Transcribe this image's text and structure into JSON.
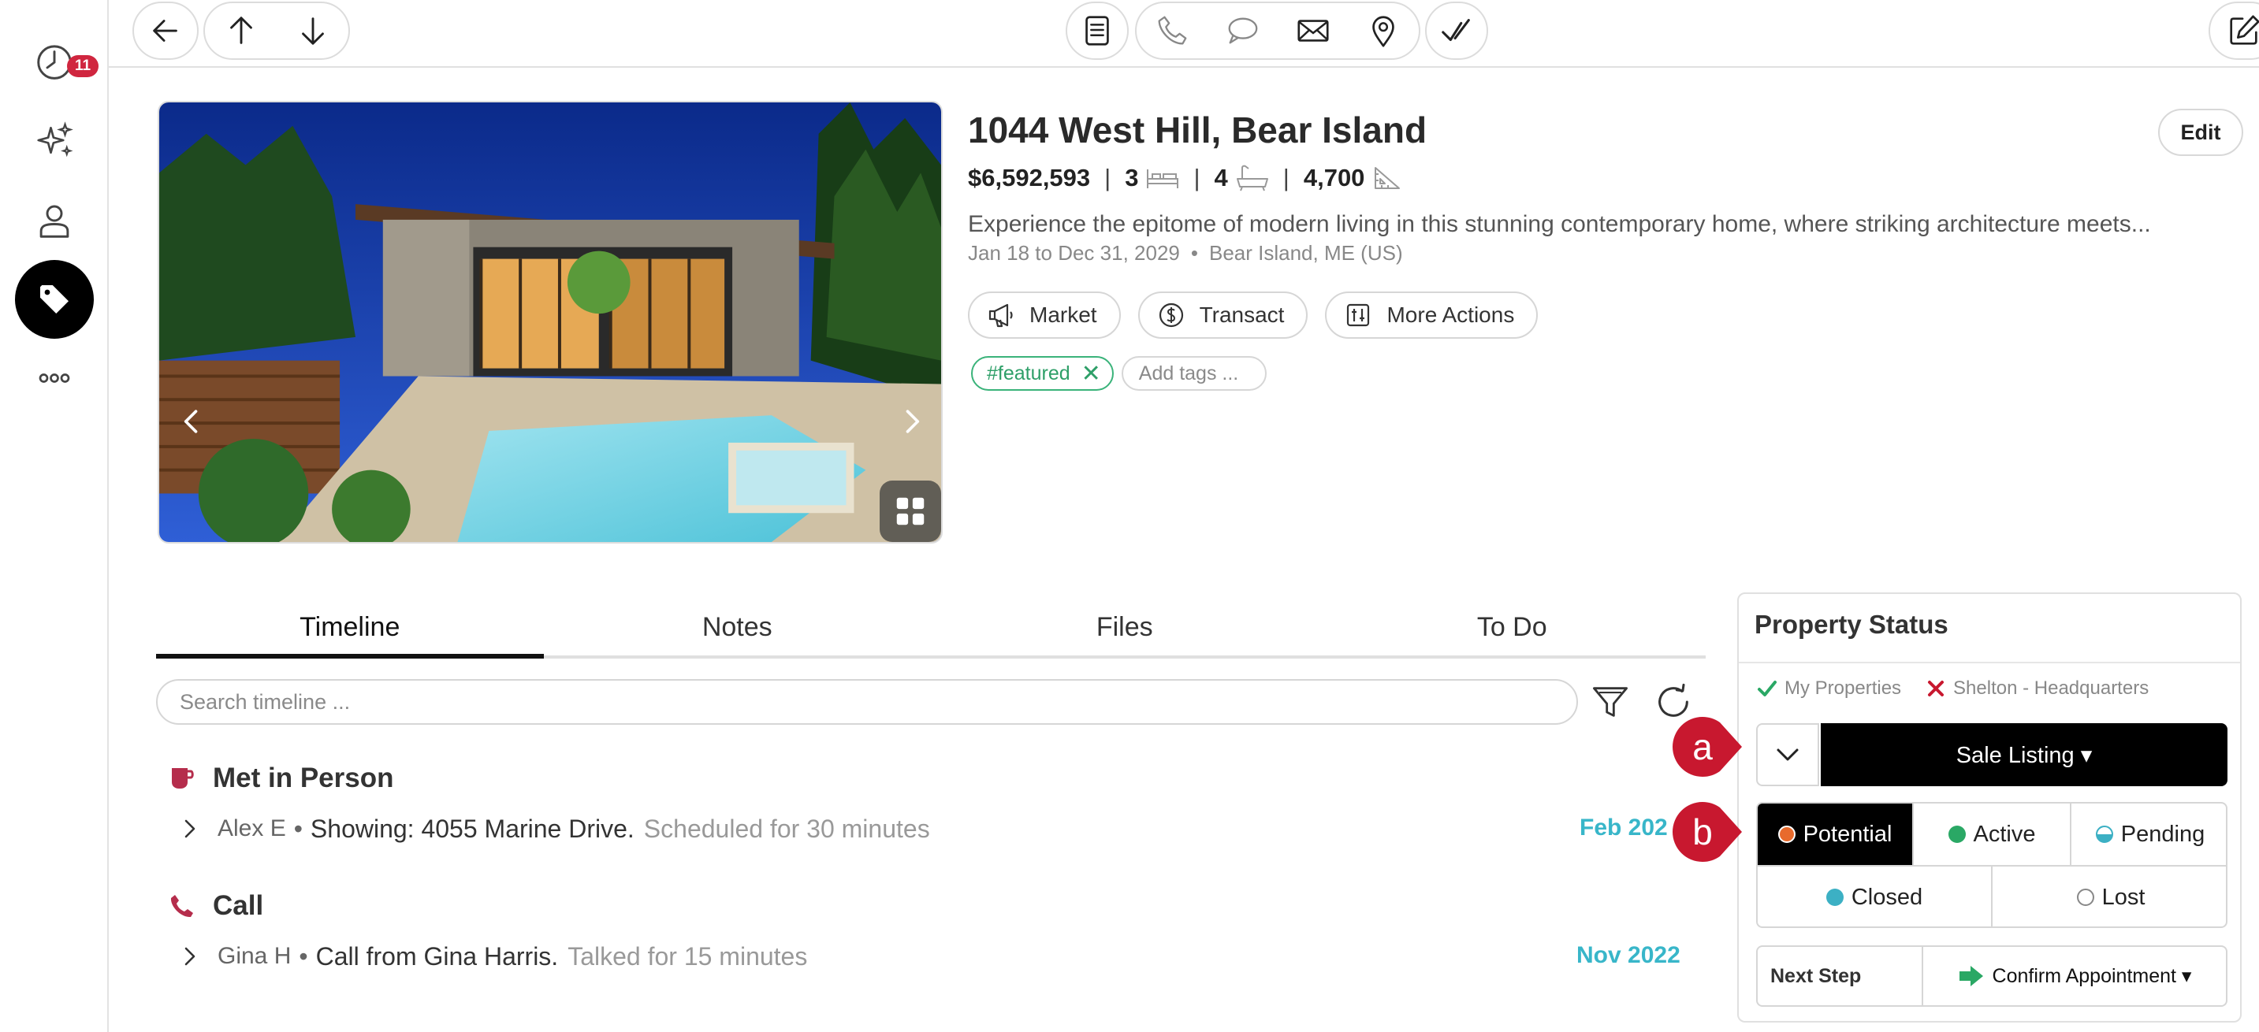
{
  "sidebar": {
    "notifications_badge": "11",
    "items": [
      {
        "icon": "clock-icon"
      },
      {
        "icon": "sparkles-icon"
      },
      {
        "icon": "person-icon"
      },
      {
        "icon": "tag-icon",
        "active": true
      },
      {
        "icon": "more-icon"
      }
    ]
  },
  "toolbar": {
    "icons": [
      "back-arrow-icon",
      "up-arrow-icon",
      "down-arrow-icon",
      "document-icon",
      "phone-icon",
      "chat-icon",
      "mail-icon",
      "map-pin-icon",
      "checkmark-icon",
      "edit-square-icon"
    ]
  },
  "property": {
    "title": "1044 West Hill, Bear Island",
    "price": "$6,592,593",
    "beds": "3",
    "baths": "4",
    "sqft": "4,700",
    "description": "Experience the epitome of modern living in this stunning contemporary home, where striking architecture meets...",
    "dates": "Jan 18 to Dec 31, 2029",
    "location": "Bear Island, ME (US)",
    "edit_label": "Edit"
  },
  "actions": {
    "market": "Market",
    "transact": "Transact",
    "more": "More Actions"
  },
  "tags": {
    "items": [
      "#featured"
    ],
    "add_placeholder": "Add tags ..."
  },
  "tabs": [
    "Timeline",
    "Notes",
    "Files",
    "To Do"
  ],
  "timeline": {
    "search_placeholder": "Search timeline ...",
    "entries": [
      {
        "type": "Met in Person",
        "who": "Alex E",
        "text": "Showing: 4055 Marine Drive.",
        "detail": "Scheduled for 30 minutes",
        "date": "Feb 202"
      },
      {
        "type": "Call",
        "who": "Gina H",
        "text": "Call from Gina Harris.",
        "detail": "Talked for 15 minutes",
        "date": "Nov 2022"
      }
    ]
  },
  "status_panel": {
    "title": "Property Status",
    "owner": "My Properties",
    "office": "Shelton - Headquarters",
    "listing_type": "Sale Listing ▾",
    "statuses": [
      "Potential",
      "Active",
      "Pending",
      "Closed",
      "Lost"
    ],
    "selected_status": "Potential",
    "next_step_label": "Next Step",
    "next_step_value": "Confirm Appointment ▾"
  },
  "callouts": [
    "a",
    "b"
  ],
  "colors": {
    "accent_teal": "#38b6c9",
    "tag_green": "#2e9f68",
    "callout_red": "#c8182f",
    "potential_orange": "#e86a2c",
    "active_green": "#2aa865",
    "closed_teal": "#3cb0c4",
    "call_icon_red": "#b52d4c"
  }
}
